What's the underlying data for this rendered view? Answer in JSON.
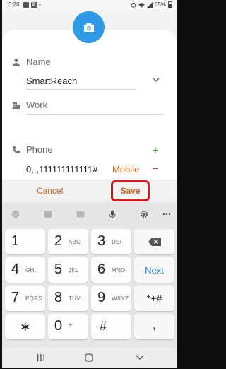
{
  "status_bar": {
    "time": "3:28",
    "battery": "65%"
  },
  "contact": {
    "name_label": "Name",
    "name_value": "SmartReach",
    "work_label": "Work",
    "phone_label": "Phone",
    "phone_value": "0,,,111111111111#",
    "phone_type": "Mobile",
    "add_symbol": "+",
    "remove_symbol": "−"
  },
  "actions": {
    "cancel": "Cancel",
    "save": "Save"
  },
  "keyboard": {
    "keys": [
      {
        "num": "1",
        "letters": ""
      },
      {
        "num": "2",
        "letters": "ABC"
      },
      {
        "num": "3",
        "letters": "DEF"
      },
      {
        "num": "4",
        "letters": "GHI"
      },
      {
        "num": "5",
        "letters": "JKL"
      },
      {
        "num": "6",
        "letters": "MNO"
      },
      {
        "num": "7",
        "letters": "PQRS"
      },
      {
        "num": "8",
        "letters": "TUV"
      },
      {
        "num": "9",
        "letters": "WXYZ"
      },
      {
        "num": "0",
        "letters": "+"
      }
    ],
    "next_label": "Next",
    "star_symbols": "*+#",
    "asterisk": "∗",
    "hash": "#",
    "comma": ","
  },
  "colors": {
    "accent_blue": "#2f9ae6",
    "action_orange": "#c8641e",
    "highlight_red": "#e0141c",
    "plus_green": "#3aa63a",
    "minus_red": "#d4433a"
  }
}
